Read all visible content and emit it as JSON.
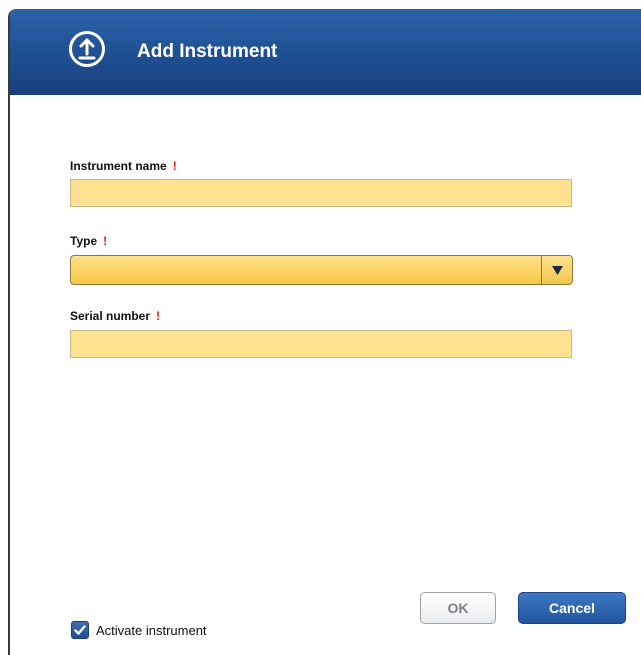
{
  "dialog": {
    "title": "Add Instrument",
    "icon": "upload-circle-icon",
    "header_color": "#1f4f93"
  },
  "form": {
    "instrument_name": {
      "label": "Instrument name",
      "required_mark": "!",
      "value": ""
    },
    "type": {
      "label": "Type",
      "required_mark": "!",
      "selected": ""
    },
    "serial_number": {
      "label": "Serial number",
      "required_mark": "!",
      "value": ""
    },
    "field_fill_color": "#ffe190",
    "required_color": "#e0241b"
  },
  "footer": {
    "activate_checkbox": {
      "label": "Activate instrument",
      "checked": true
    },
    "ok_label": "OK",
    "cancel_label": "Cancel"
  }
}
